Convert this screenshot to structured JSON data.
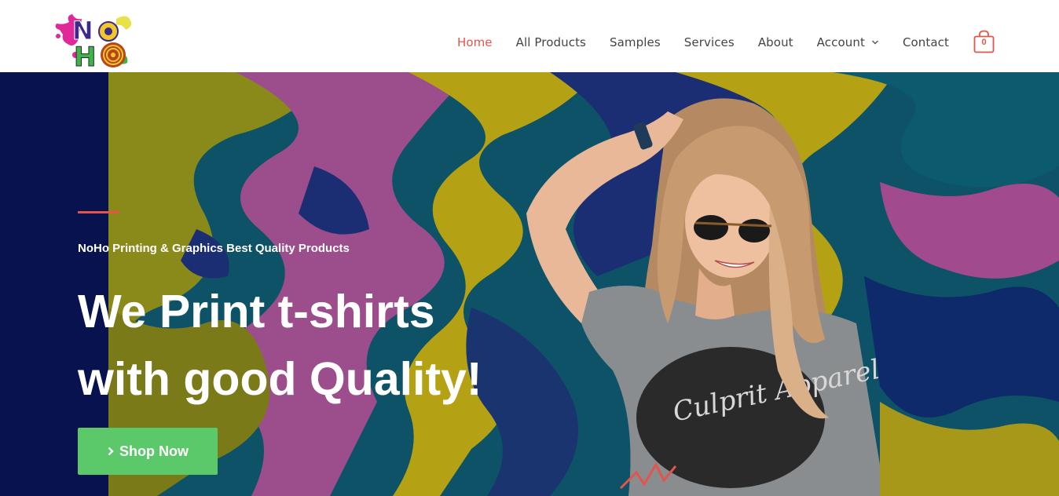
{
  "header": {
    "logo_text": "NoHo",
    "nav": [
      {
        "label": "Home",
        "active": true
      },
      {
        "label": "All Products",
        "active": false
      },
      {
        "label": "Samples",
        "active": false
      },
      {
        "label": "Services",
        "active": false
      },
      {
        "label": "About",
        "active": false
      },
      {
        "label": "Account",
        "active": false,
        "dropdown": true
      },
      {
        "label": "Contact",
        "active": false
      }
    ],
    "cart_count": "0"
  },
  "hero": {
    "subtitle": "NoHo Printing & Graphics Best Quality Products",
    "headline_line1": "We Print t-shirts",
    "headline_line2": "with good Quality!",
    "cta_label": "Shop Now",
    "shirt_text": "Culprit Apparel"
  },
  "colors": {
    "accent": "#e4544a",
    "cta": "#5bc86a",
    "navy": "#07124f",
    "nav_text": "#444444"
  },
  "icons": {
    "cart": "shopping-bag-icon",
    "cta_arrow": "chevron-right-icon",
    "dropdown": "chevron-down-icon"
  }
}
